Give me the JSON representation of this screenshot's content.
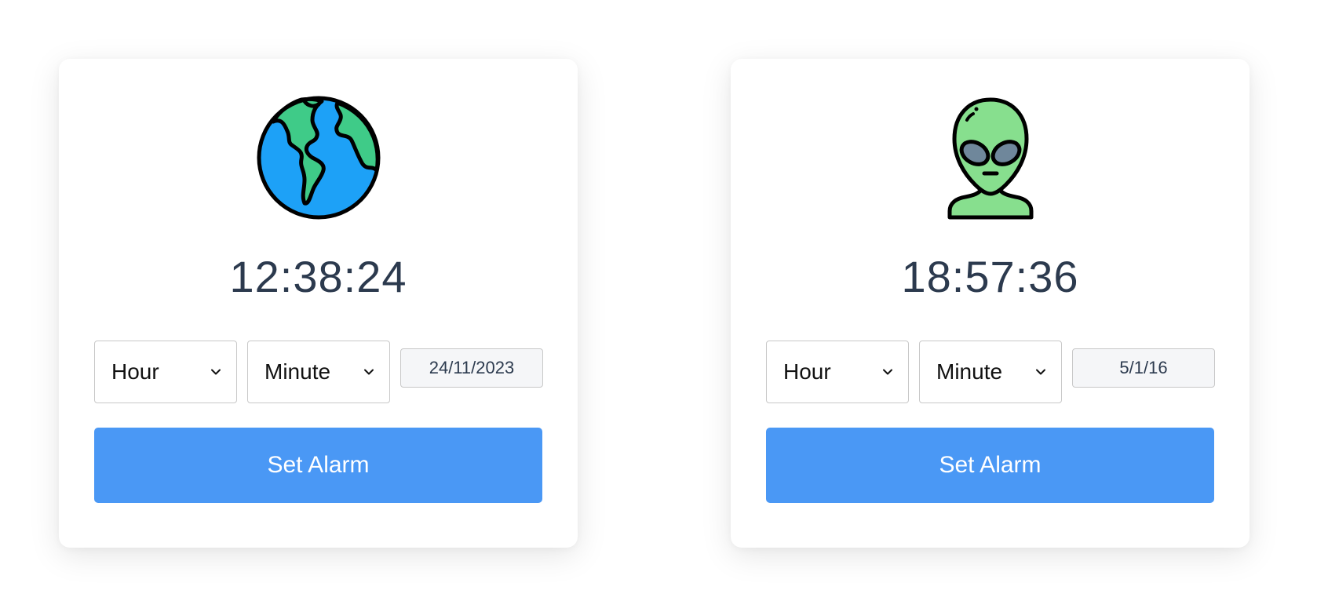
{
  "cards": [
    {
      "icon": "earth-globe-icon",
      "time": "12:38:24",
      "hour_select": "Hour",
      "minute_select": "Minute",
      "date": "24/11/2023",
      "button_label": "Set Alarm"
    },
    {
      "icon": "alien-head-icon",
      "time": "18:57:36",
      "hour_select": "Hour",
      "minute_select": "Minute",
      "date": "5/1/16",
      "button_label": "Set Alarm"
    }
  ],
  "colors": {
    "button": "#4a98f5",
    "clock_text": "#2c3a4e",
    "earth_ocean": "#1da1f7",
    "earth_land": "#3fcb88",
    "alien_skin": "#87df8e",
    "alien_eyes": "#6f879b"
  }
}
